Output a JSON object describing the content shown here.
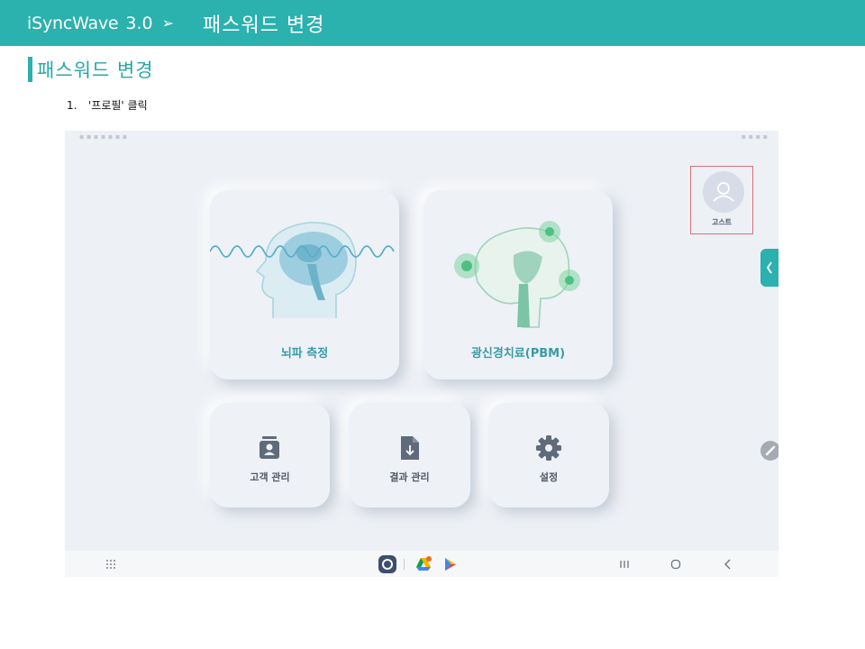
{
  "header": {
    "app_name": "iSyncWave",
    "version": "3.0",
    "arrow": "➢",
    "title": "패스워드 변경"
  },
  "section": {
    "heading": "패스워드 변경"
  },
  "steps": [
    {
      "number": "1.",
      "text": "'프로필' 클릭"
    }
  ],
  "tablet": {
    "profile": {
      "name": "고스트"
    },
    "cards": {
      "eeg_label": "뇌파 측정",
      "pbm_label": "광신경치료(PBM)",
      "customer_label": "고객 관리",
      "results_label": "결과 관리",
      "settings_label": "설정"
    },
    "icons": {
      "profile": "person-icon",
      "side_tab": "chevron-left-icon",
      "edit": "pencil-icon",
      "customer": "contact-card-icon",
      "results": "file-download-icon",
      "settings": "gear-icon",
      "apps": "app-grid-icon",
      "recents": "recents-icon",
      "home": "home-icon",
      "back": "back-icon"
    }
  },
  "colors": {
    "accent": "#2bb1ae",
    "highlight_border": "#d9707a",
    "card_label": "#3a9ba6"
  }
}
